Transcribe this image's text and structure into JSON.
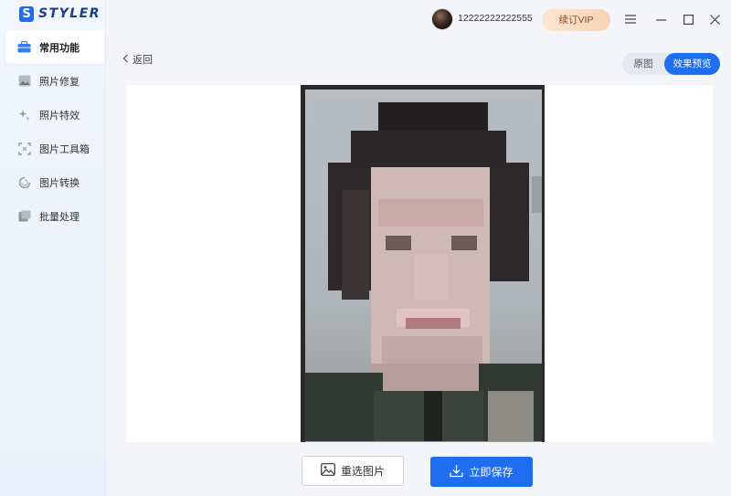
{
  "app": {
    "logo_mark": "S",
    "logo_text": "STYLER"
  },
  "sidebar": {
    "items": [
      {
        "label": "常用功能",
        "icon": "toolbox-icon",
        "active": true
      },
      {
        "label": "照片修复",
        "icon": "photo-repair-icon",
        "active": false
      },
      {
        "label": "照片特效",
        "icon": "sparkle-effects-icon",
        "active": false
      },
      {
        "label": "图片工具箱",
        "icon": "tools-grid-icon",
        "active": false
      },
      {
        "label": "图片转换",
        "icon": "convert-icon",
        "active": false
      },
      {
        "label": "批量处理",
        "icon": "batch-icon",
        "active": false
      }
    ]
  },
  "header": {
    "user_id": "12222222222555",
    "vip_label": "续订VIP"
  },
  "main": {
    "back_label": "返回",
    "view_toggle": {
      "original": "原图",
      "preview": "效果预览",
      "selected": "preview"
    },
    "reselect_label": "重选图片",
    "save_label": "立即保存"
  },
  "colors": {
    "accent": "#1f6df0",
    "vip_bg": "#fde6d1",
    "vip_text": "#8a4a1f"
  }
}
